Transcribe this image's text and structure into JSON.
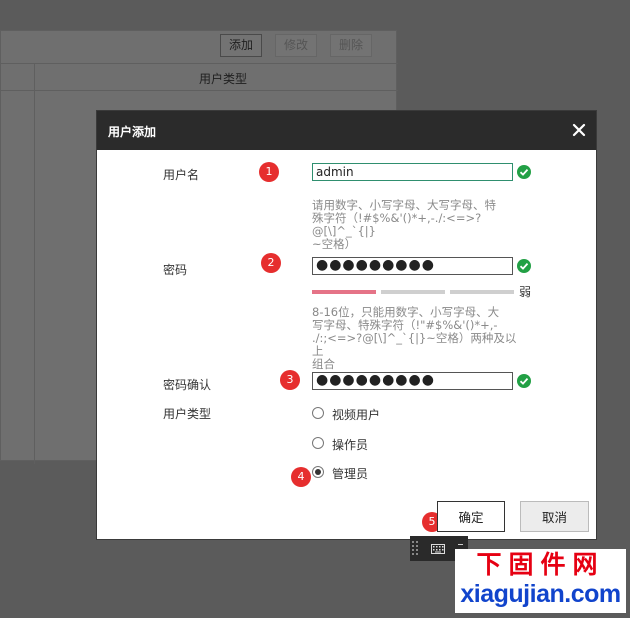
{
  "background": {
    "toolbar": {
      "add_label": "添加",
      "edit_label": "修改",
      "delete_label": "删除"
    },
    "table": {
      "column_header": "用户类型"
    }
  },
  "dialog": {
    "title": "用户添加",
    "username": {
      "label": "用户名",
      "value": "admin",
      "hint": [
        "请用数字、小写字母、大写字母、特",
        "殊字符（!#$%&'()*+,-./:<=>?@[\\]^_`{|}",
        "~空格）"
      ]
    },
    "password": {
      "label": "密码",
      "value": "●●●●●●●●●",
      "strength_text": "弱",
      "hint": [
        "8-16位，只能用数字、小写字母、大",
        "写字母、特殊字符（!\"#$%&'()*+,-",
        "./:;<=>?@[\\]^_`{|}~空格）两种及以上",
        "组合"
      ]
    },
    "confirm": {
      "label": "密码确认",
      "value": "●●●●●●●●●"
    },
    "user_type": {
      "label": "用户类型",
      "options": [
        "视频用户",
        "操作员",
        "管理员"
      ],
      "selected": "管理员"
    },
    "ok_label": "确定",
    "cancel_label": "取消"
  },
  "steps": [
    "1",
    "2",
    "3",
    "4",
    "5"
  ],
  "colors": {
    "accent_green": "#22a045",
    "step_red": "#e62e2e",
    "strength_weak": "#e57387"
  },
  "watermark": {
    "cn": "下固件网",
    "en": "xiagujian.com"
  }
}
